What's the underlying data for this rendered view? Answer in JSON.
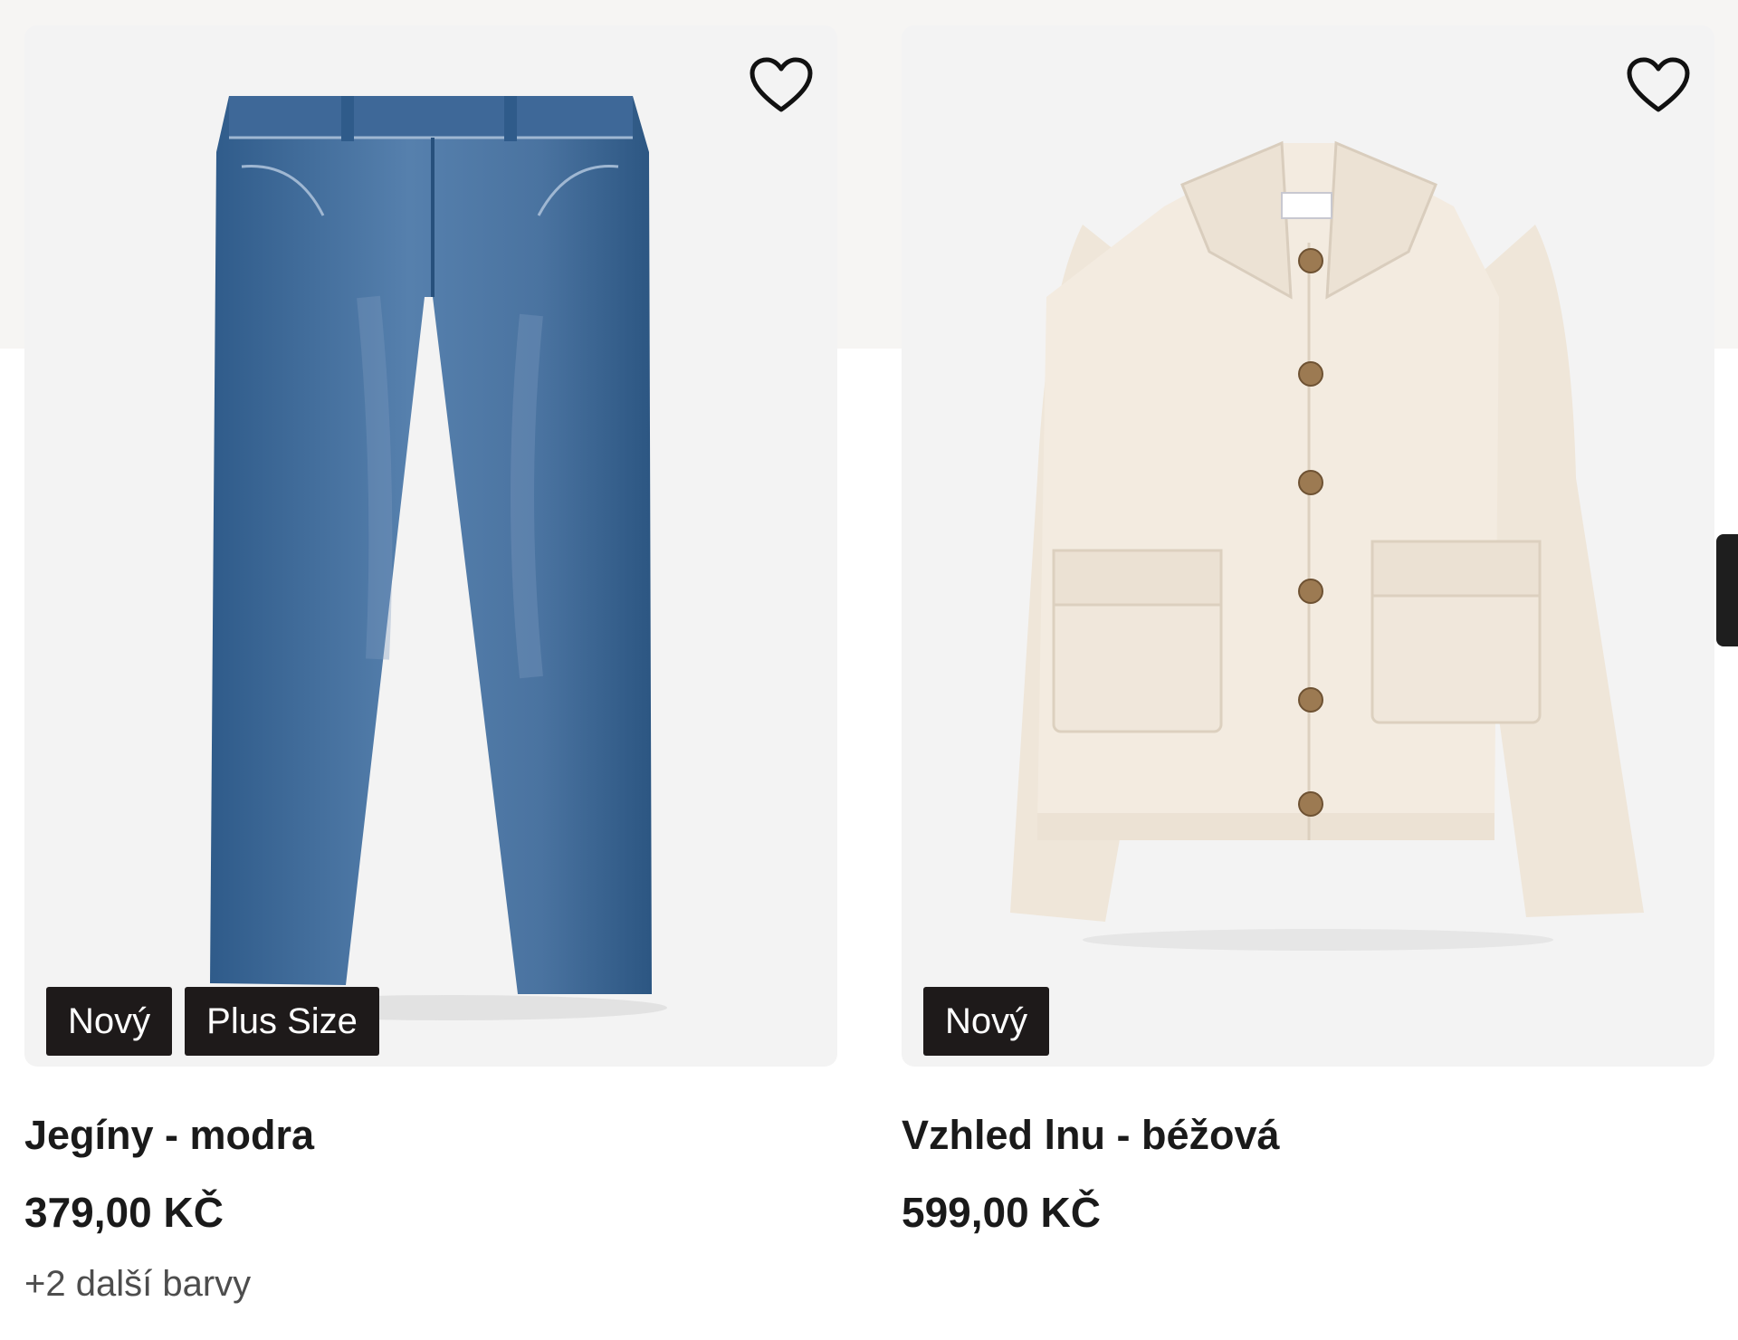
{
  "products": [
    {
      "badges": [
        "Nový",
        "Plus Size"
      ],
      "name": "Jegíny - modra",
      "price": "379,00 KČ",
      "more_colors": "+2 další barvy",
      "image_icon": "jeans-image",
      "favorite_icon": "heart-outline-icon"
    },
    {
      "badges": [
        "Nový"
      ],
      "name": "Vzhled lnu - béžová",
      "price": "599,00 KČ",
      "image_icon": "jacket-image",
      "favorite_icon": "heart-outline-icon"
    }
  ],
  "colors": {
    "badge_bg": "#1e1a1a",
    "image_bg": "#f3f3f3",
    "top_band": "#f6f5f3",
    "text": "#1a1a1a",
    "muted_text": "#4d4d4d"
  }
}
